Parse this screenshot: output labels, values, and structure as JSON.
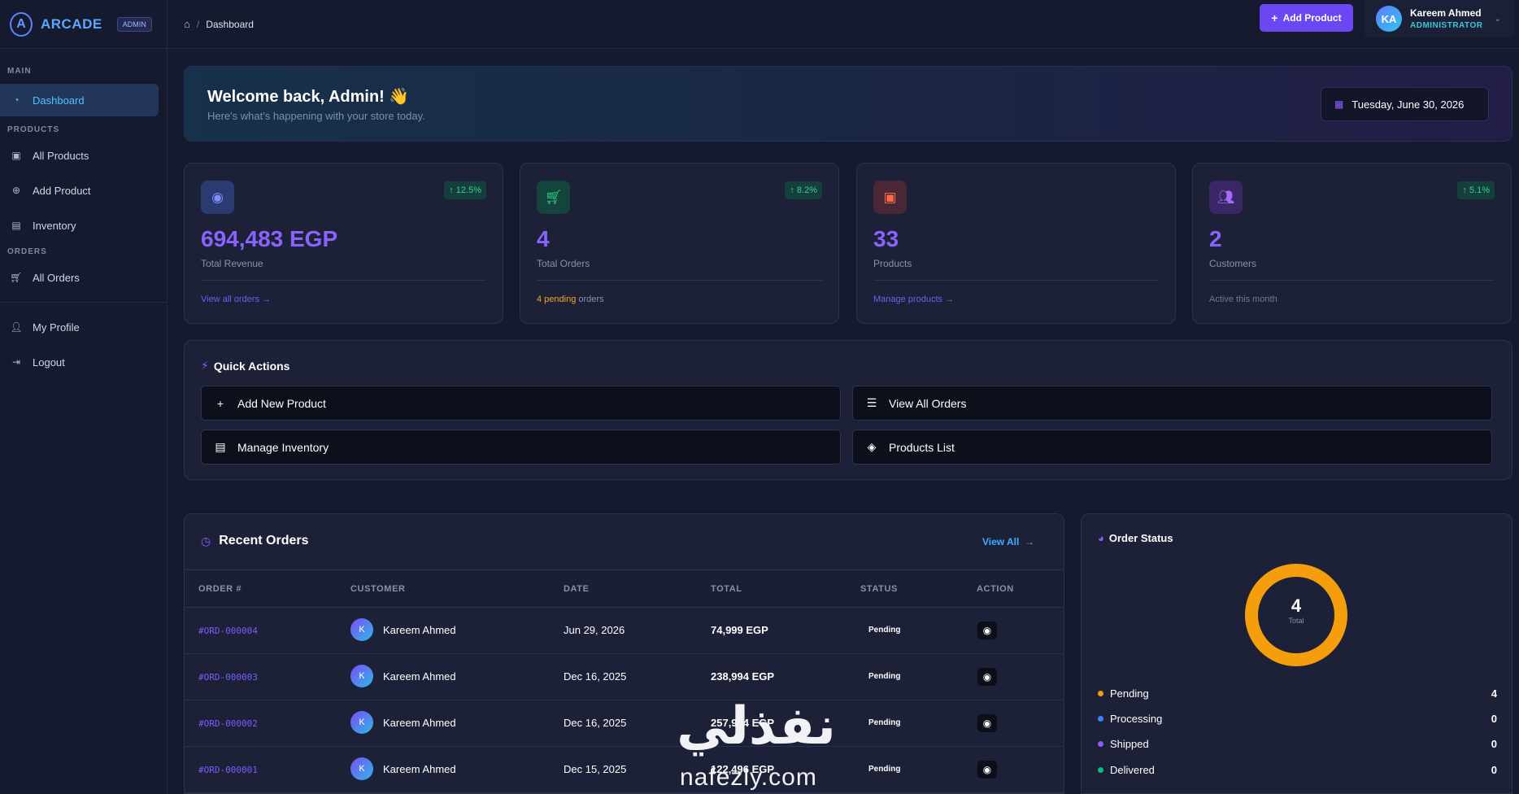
{
  "brand": {
    "name": "ARCADE",
    "badge": "ADMIN",
    "logo_letter": "A"
  },
  "sidebar": {
    "sections": {
      "main": "MAIN",
      "products": "PRODUCTS",
      "orders": "ORDERS"
    },
    "items": [
      {
        "label": "Dashboard",
        "icon": "gauge-icon"
      },
      {
        "label": "All Products",
        "icon": "box-icon"
      },
      {
        "label": "Add Product",
        "icon": "plus-circle-icon"
      },
      {
        "label": "Inventory",
        "icon": "warehouse-icon"
      },
      {
        "label": "All Orders",
        "icon": "cart-icon"
      },
      {
        "label": "My Profile",
        "icon": "user-gear-icon"
      },
      {
        "label": "Logout",
        "icon": "logout-icon"
      }
    ]
  },
  "topbar": {
    "breadcrumb": "Dashboard",
    "add_button": "Add Product",
    "user": {
      "initials": "KA",
      "name": "Kareem Ahmed",
      "role": "ADMINISTRATOR"
    }
  },
  "welcome": {
    "title": "Welcome back, Admin!",
    "emoji": "👋",
    "subtitle": "Here's what's happening with your store today.",
    "date": "Tuesday, June 30, 2026"
  },
  "stats": [
    {
      "value": "694,483 EGP",
      "label": "Total Revenue",
      "badge": "12.5%",
      "foot": "View all orders →",
      "icon": "coins-icon",
      "icon_bg": "#2b3b72",
      "icon_color": "#7d8cff"
    },
    {
      "value": "4",
      "label": "Total Orders",
      "badge": "8.2%",
      "foot_count": "4 pending",
      "foot_rest": "orders",
      "icon": "cart-icon",
      "icon_bg": "#13453d",
      "icon_color": "#2fd28c"
    },
    {
      "value": "33",
      "label": "Products",
      "badge": "",
      "foot": "Manage products →",
      "icon": "box-icon",
      "icon_bg": "#4a2736",
      "icon_color": "#ff6a4d"
    },
    {
      "value": "2",
      "label": "Customers",
      "badge": "5.1%",
      "foot": "Active this month",
      "icon": "users-icon",
      "icon_bg": "#3a2766",
      "icon_color": "#a56bff"
    }
  ],
  "quick_actions": {
    "title": "Quick Actions",
    "buttons": [
      "Add New Product",
      "View All Orders",
      "Manage Inventory",
      "Products List"
    ]
  },
  "recent_orders": {
    "title": "Recent Orders",
    "view_all": "View All",
    "columns": [
      "ORDER #",
      "CUSTOMER",
      "DATE",
      "TOTAL",
      "STATUS",
      "ACTION"
    ],
    "rows": [
      {
        "id": "#ORD-000004",
        "initial": "K",
        "customer": "Kareem Ahmed",
        "date": "Jun 29, 2026",
        "total": "74,999 EGP",
        "status": "Pending"
      },
      {
        "id": "#ORD-000003",
        "initial": "K",
        "customer": "Kareem Ahmed",
        "date": "Dec 16, 2025",
        "total": "238,994 EGP",
        "status": "Pending"
      },
      {
        "id": "#ORD-000002",
        "initial": "K",
        "customer": "Kareem Ahmed",
        "date": "Dec 16, 2025",
        "total": "257,994 EGP",
        "status": "Pending"
      },
      {
        "id": "#ORD-000001",
        "initial": "K",
        "customer": "Kareem Ahmed",
        "date": "Dec 15, 2025",
        "total": "122,496 EGP",
        "status": "Pending"
      }
    ]
  },
  "order_status": {
    "title": "Order Status",
    "total": "4",
    "total_label": "Total",
    "items": [
      {
        "label": "Pending",
        "count": "4",
        "color": "#f59e0b"
      },
      {
        "label": "Processing",
        "count": "0",
        "color": "#3b82f6"
      },
      {
        "label": "Shipped",
        "count": "0",
        "color": "#8b5cf6"
      },
      {
        "label": "Delivered",
        "count": "0",
        "color": "#10b981"
      }
    ]
  },
  "watermark": {
    "arabic": "نفذلي",
    "latin": "nafezly.com"
  }
}
